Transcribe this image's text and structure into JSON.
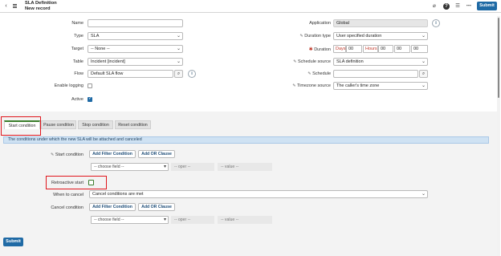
{
  "header": {
    "title": "SLA Definition",
    "subtitle": "New record",
    "submit_label": "Submit",
    "icons": [
      "paperclip-icon",
      "help-icon",
      "more-icon",
      "overflow-menu-icon"
    ]
  },
  "form": {
    "name": {
      "label": "Name",
      "value": ""
    },
    "type": {
      "label": "Type",
      "value": "SLA"
    },
    "target": {
      "label": "Target",
      "value": "-- None --"
    },
    "table": {
      "label": "Table",
      "value": "Incident [incident]"
    },
    "flow": {
      "label": "Flow",
      "value": "Default SLA flow"
    },
    "enable_logging": {
      "label": "Enable logging",
      "checked": false
    },
    "active": {
      "label": "Active",
      "checked": true
    },
    "application": {
      "label": "Application",
      "value": "Global"
    },
    "duration_type": {
      "label": "Duration type",
      "value": "User specified duration"
    },
    "duration": {
      "label": "Duration",
      "days_placeholder": "Days",
      "days_value": "00",
      "hours_placeholder": "Hours",
      "hours_value": "00",
      "minutes_value": "00",
      "seconds_value": "00"
    },
    "schedule_source": {
      "label": "Schedule source",
      "value": "SLA definition"
    },
    "schedule": {
      "label": "Schedule",
      "value": ""
    },
    "timezone_source": {
      "label": "Timezone source",
      "value": "The caller's time zone"
    }
  },
  "tabs": [
    {
      "label": "Start condition",
      "active": true
    },
    {
      "label": "Pause condition",
      "active": false
    },
    {
      "label": "Stop condition",
      "active": false
    },
    {
      "label": "Reset condition",
      "active": false
    }
  ],
  "conditions": {
    "info": "The conditions under which the new SLA will be attached and canceled",
    "start_condition_label": "Start condition",
    "add_filter_label": "Add Filter Condition",
    "add_or_label": "Add OR Clause",
    "choose_field": "-- choose field --",
    "oper": "-- oper --",
    "value": "-- value --",
    "retroactive_start_label": "Retroactive start",
    "retroactive_start_checked": false,
    "when_to_cancel_label": "When to cancel",
    "when_to_cancel_value": "Cancel conditions are met",
    "cancel_condition_label": "Cancel condition"
  },
  "footer": {
    "submit_label": "Submit"
  }
}
